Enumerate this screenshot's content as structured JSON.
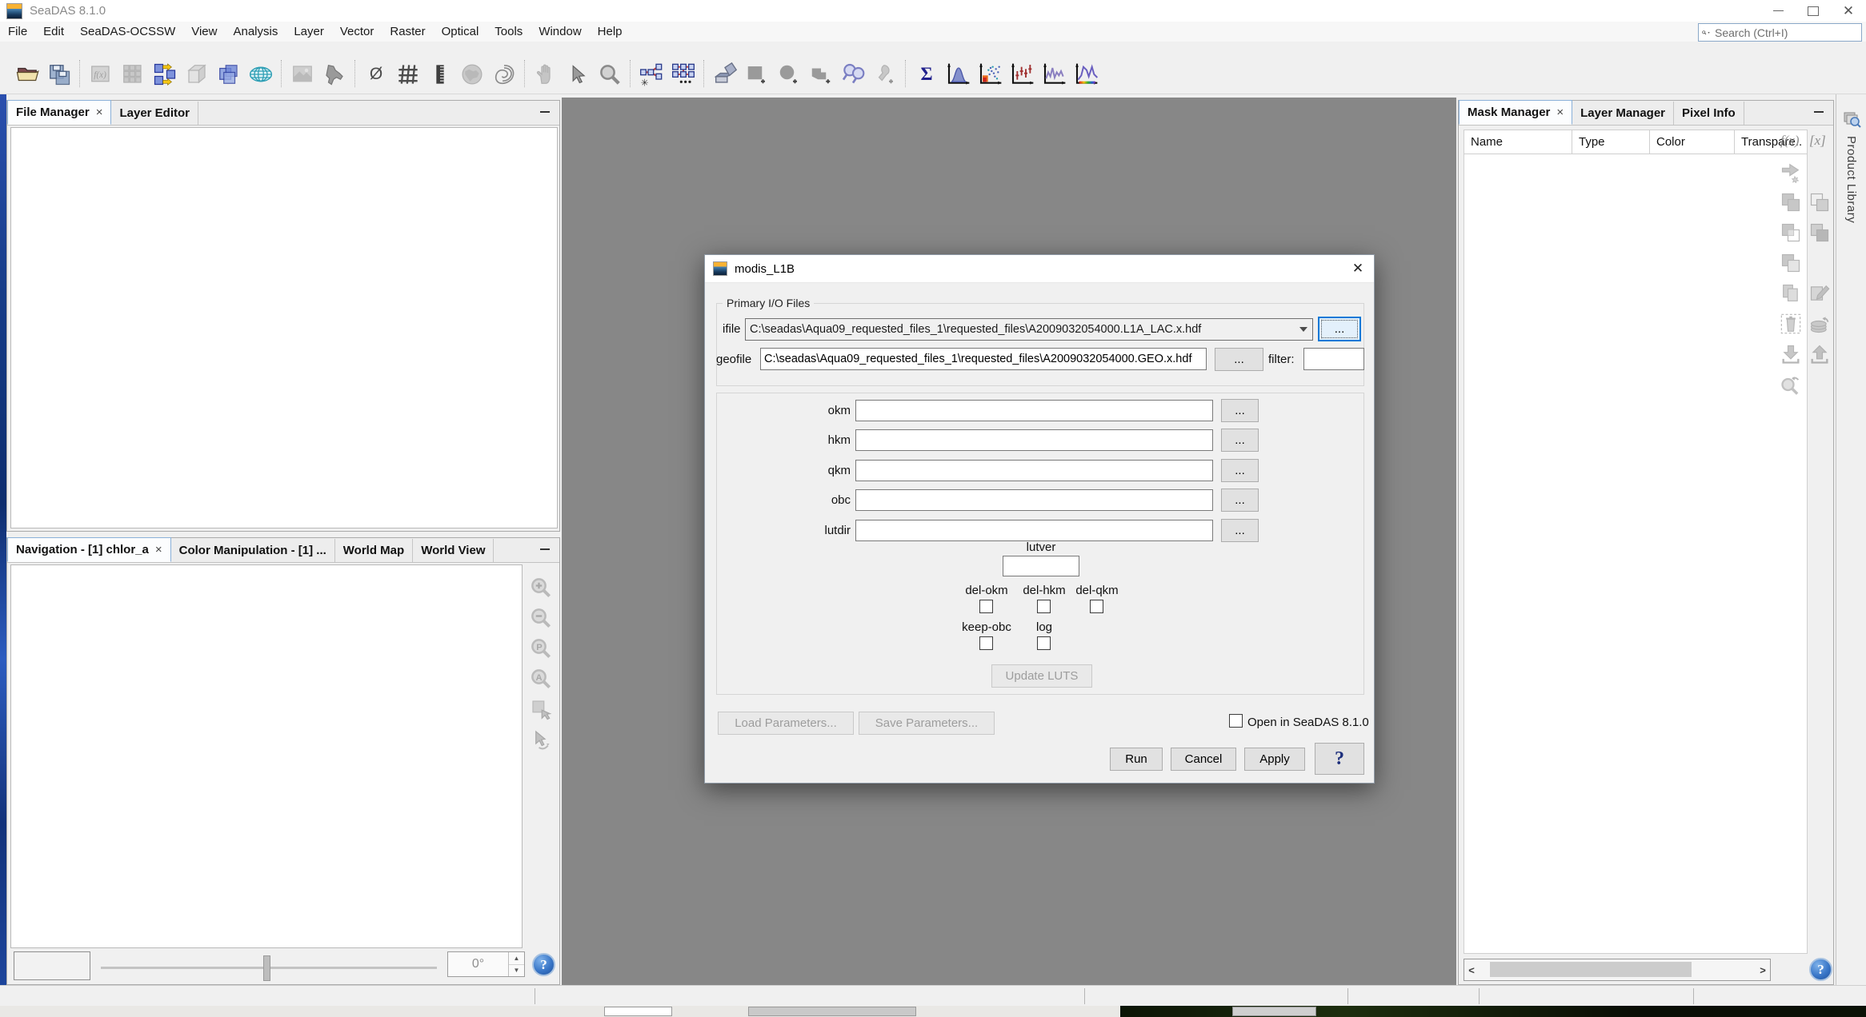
{
  "window": {
    "title": "SeaDAS 8.1.0"
  },
  "icons": {
    "close_glyph": "✕",
    "tab_close_glyph": "×",
    "no_data_glyph": "Ø",
    "sigma_glyph": "Σ",
    "fx_label": "f(x)",
    "bracket_label": "[x]",
    "scroll_left": "<",
    "scroll_right": ">",
    "spin_up": "▲",
    "spin_down": "▼",
    "help_glyph": "?"
  },
  "menu": {
    "items": [
      "File",
      "Edit",
      "SeaDAS-OCSSW",
      "View",
      "Analysis",
      "Layer",
      "Vector",
      "Raster",
      "Optical",
      "Tools",
      "Window",
      "Help"
    ]
  },
  "search": {
    "placeholder": "Search (Ctrl+I)"
  },
  "left_top_panel": {
    "tabs": [
      {
        "label": "File Manager"
      },
      {
        "label": "Layer Editor"
      }
    ]
  },
  "left_bottom_panel": {
    "tabs": [
      {
        "label": "Navigation - [1] chlor_a"
      },
      {
        "label": "Color Manipulation - [1] ..."
      },
      {
        "label": "World Map"
      },
      {
        "label": "World View"
      }
    ],
    "rotation": "0°"
  },
  "right_panel": {
    "tabs": [
      {
        "label": "Mask Manager"
      },
      {
        "label": "Layer Manager"
      },
      {
        "label": "Pixel Info"
      }
    ],
    "columns": [
      "Name",
      "Type",
      "Color",
      "Transpare.."
    ]
  },
  "product_library": {
    "label": "Product Library"
  },
  "dialog": {
    "title": "modis_L1B",
    "io_group": {
      "title": "Primary I/O Files",
      "ifile": {
        "label": "ifile",
        "value": "C:\\seadas\\Aqua09_requested_files_1\\requested_files\\A2009032054000.L1A_LAC.x.hdf"
      },
      "geofile": {
        "label": "geofile",
        "value": "C:\\seadas\\Aqua09_requested_files_1\\requested_files\\A2009032054000.GEO.x.hdf"
      },
      "filter": {
        "label": "filter:",
        "value": ""
      },
      "browse": "..."
    },
    "params": {
      "rows": [
        {
          "label": "okm"
        },
        {
          "label": "hkm"
        },
        {
          "label": "qkm"
        },
        {
          "label": "obc"
        },
        {
          "label": "lutdir"
        }
      ],
      "browse": "...",
      "lutver_label": "lutver",
      "checks_row1": [
        "del-okm",
        "del-hkm",
        "del-qkm"
      ],
      "checks_row2": [
        "keep-obc",
        "log"
      ],
      "update_luts": "Update LUTS"
    },
    "footer": {
      "load": "Load Parameters...",
      "save": "Save Parameters...",
      "open_in": "Open in SeaDAS 8.1.0",
      "run": "Run",
      "cancel": "Cancel",
      "apply": "Apply",
      "help": "?"
    }
  },
  "colors": {
    "workspace": "#878787",
    "accent_blue": "#0078d7",
    "desktop_edge_blue": "#1e47a0",
    "help_button_blue": "#3a77c8"
  }
}
